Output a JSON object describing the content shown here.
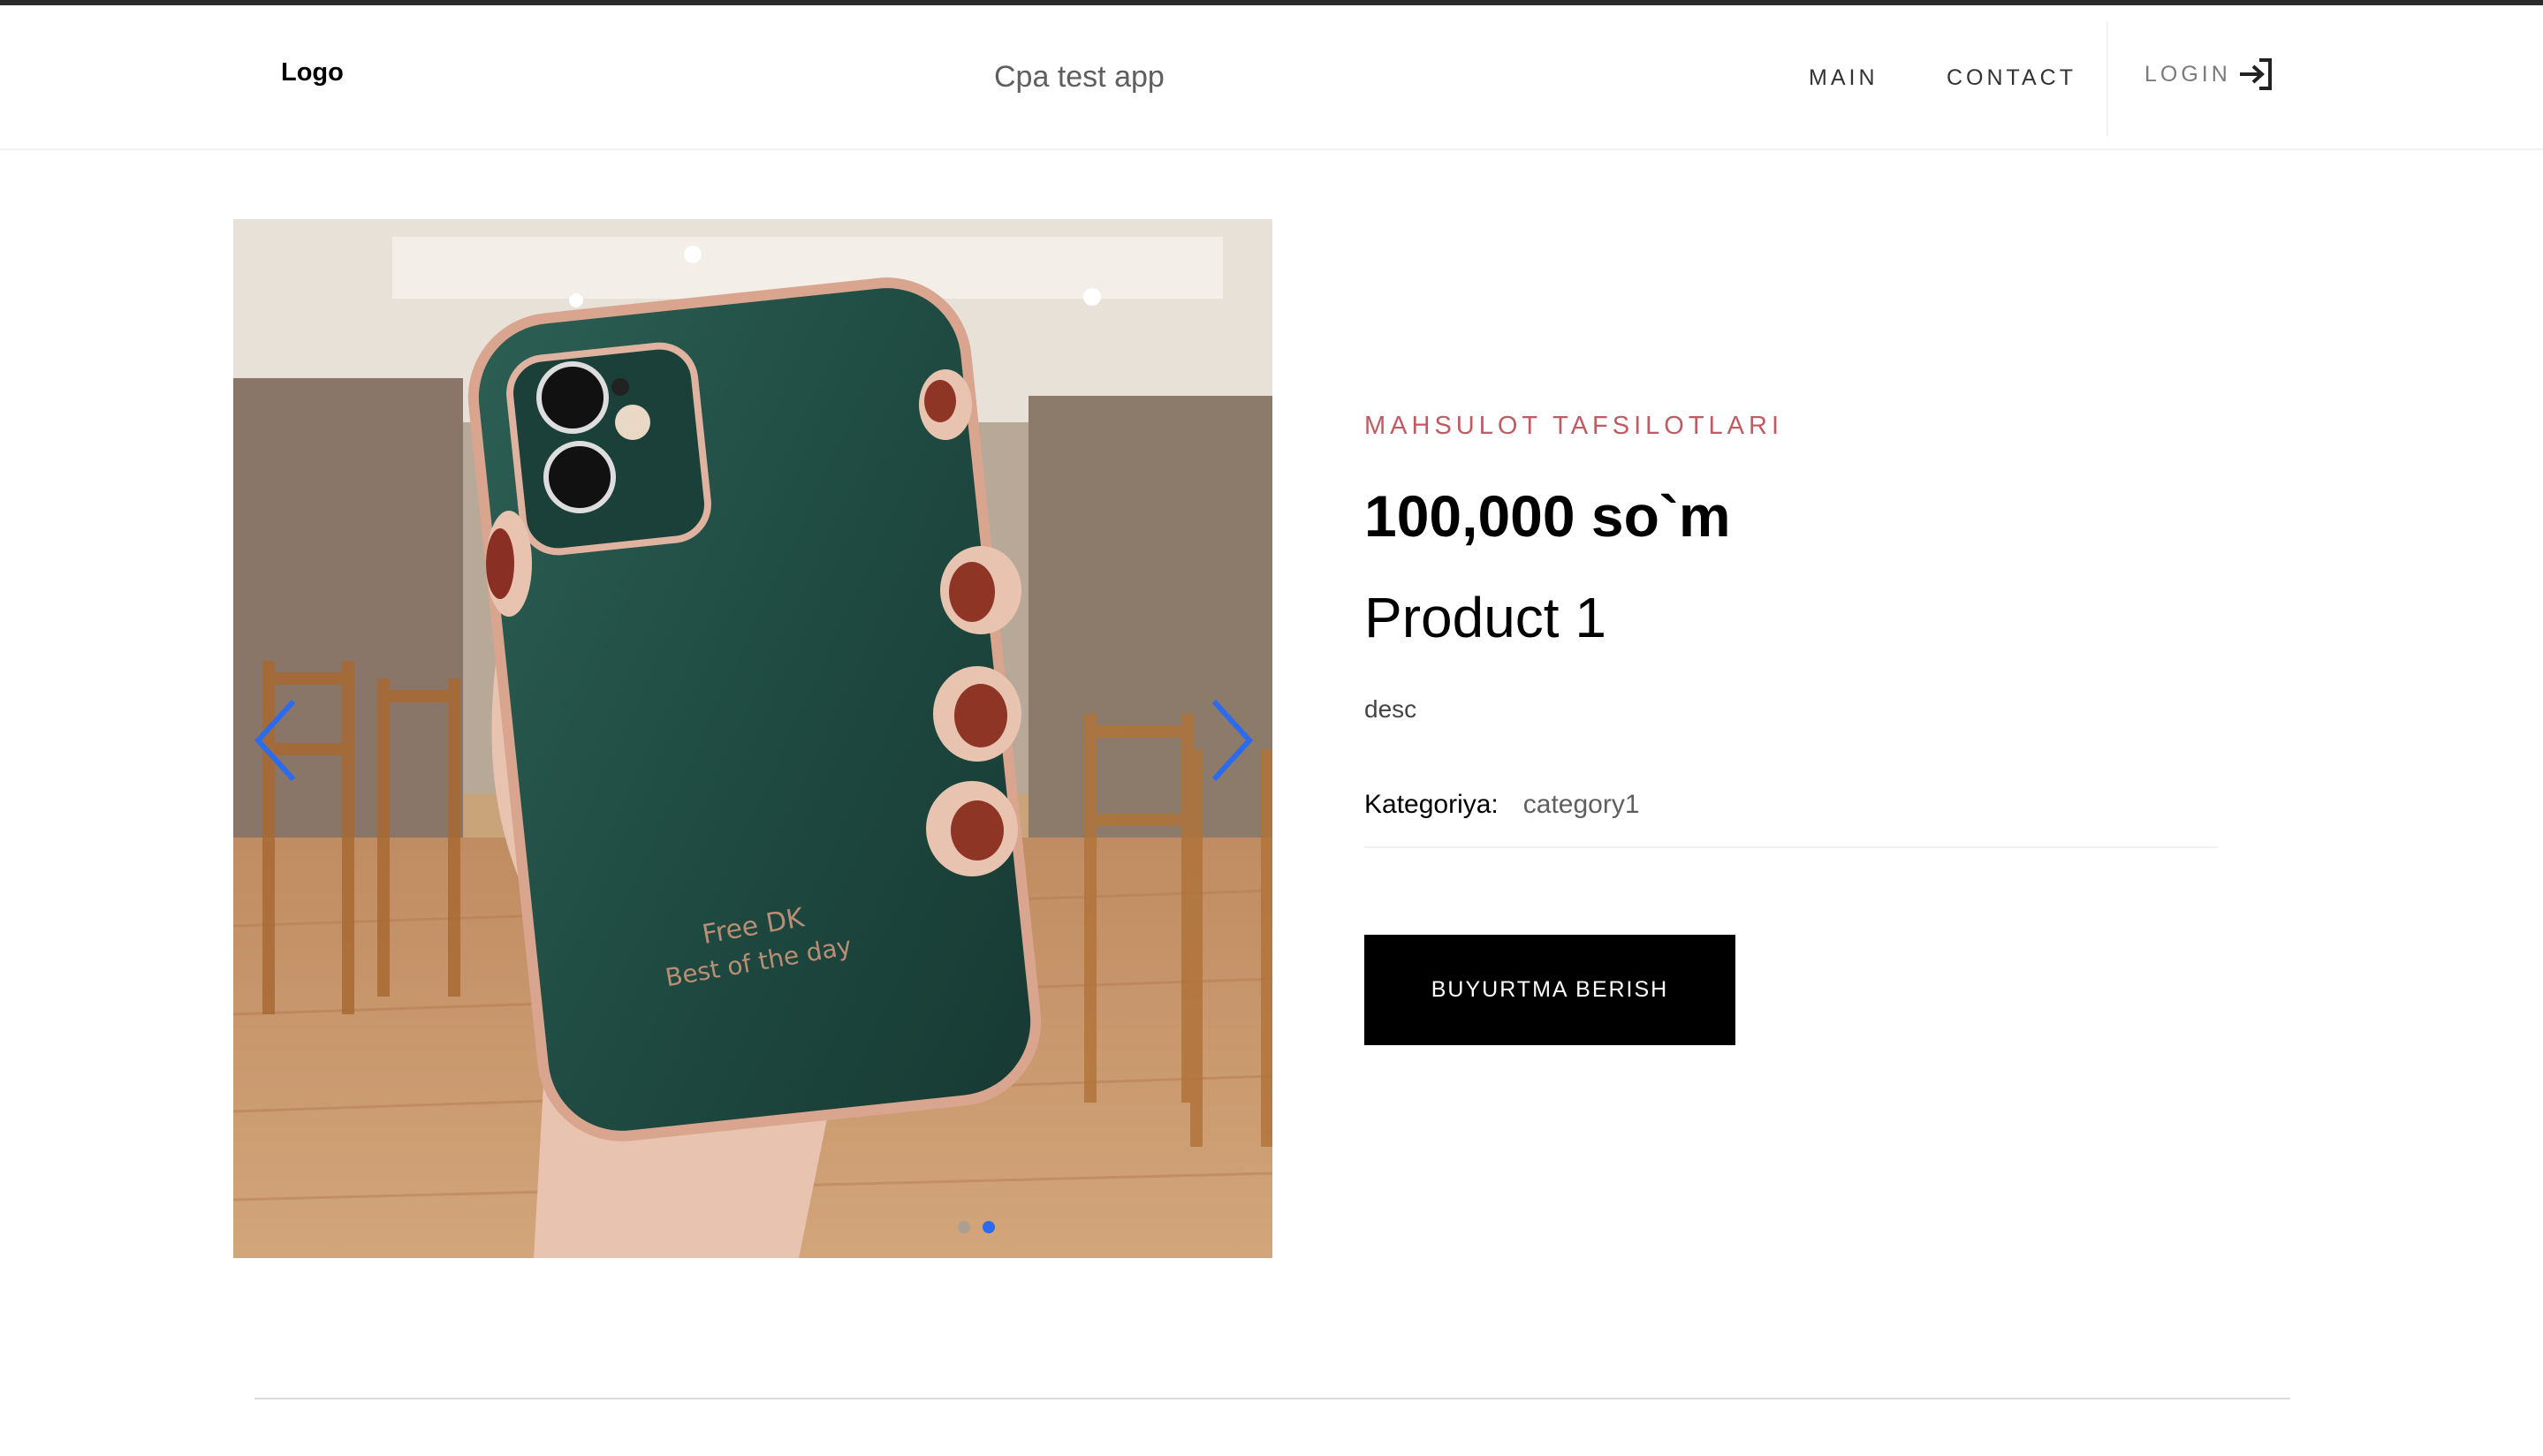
{
  "header": {
    "logo": "Logo",
    "app_title": "Cpa test app",
    "nav": {
      "main": "MAIN",
      "contact": "CONTACT",
      "login": "LOGIN"
    }
  },
  "product": {
    "eyebrow": "MAHSULOT TAFSILOTLARI",
    "price": "100,000 so`m",
    "name": "Product 1",
    "description": "desc",
    "category_label": "Kategoriya:",
    "category_value": "category1",
    "order_button": "BUYURTMA BERISH"
  },
  "carousel": {
    "slide_count": 2,
    "active_slide": 2,
    "image_text_line1": "Free DK",
    "image_text_line2": "Best of the day"
  },
  "colors": {
    "accent_eyebrow": "#c05b62",
    "button_bg": "#000000",
    "carousel_arrow": "#2c6bed"
  }
}
